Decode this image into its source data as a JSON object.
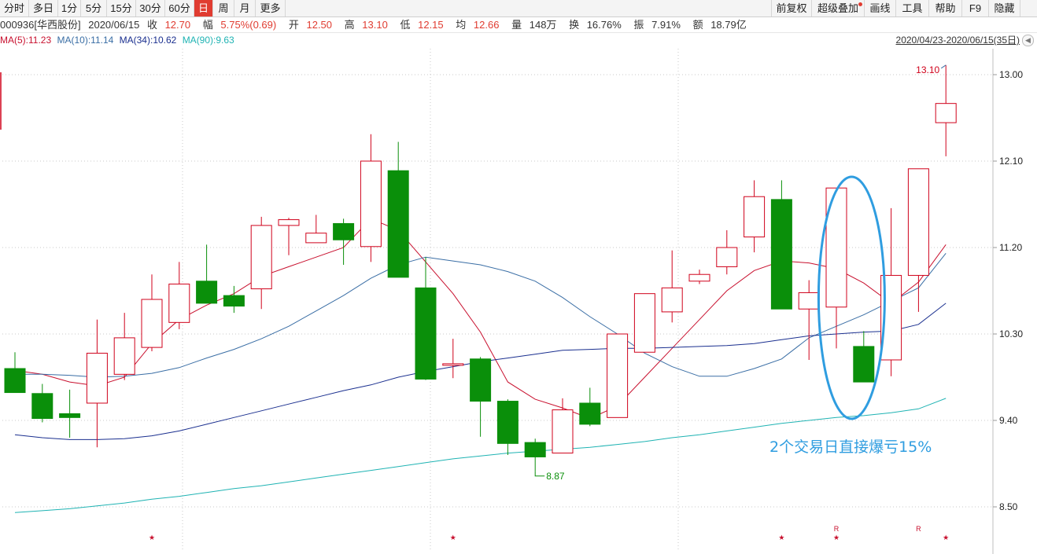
{
  "toolbar": {
    "left_items": [
      "分时",
      "多日",
      "1分",
      "5分",
      "15分",
      "30分",
      "60分",
      "日",
      "周",
      "月",
      "更多"
    ],
    "active": "日",
    "right_items": [
      "前复权",
      "超级叠加",
      "画线",
      "工具",
      "帮助",
      "F9",
      "隐藏"
    ]
  },
  "info": {
    "code_name": "000936[华西股份]",
    "date": "2020/06/15",
    "close_label": "收",
    "close": "12.70",
    "change_label": "幅",
    "change": "5.75%(0.69)",
    "open_label": "开",
    "open": "12.50",
    "high_label": "高",
    "high": "13.10",
    "low_label": "低",
    "low": "12.15",
    "avg_label": "均",
    "avg": "12.66",
    "volume_label": "量",
    "volume": "148万",
    "turnover_label": "换",
    "turnover": "16.76%",
    "amplitude_label": "振",
    "amplitude": "7.91%",
    "amount_label": "额",
    "amount": "18.79亿"
  },
  "ma_legend": [
    {
      "text": "MA(5):11.23",
      "color": "#c8102e"
    },
    {
      "text": "MA(10):11.14",
      "color": "#3a6ea5"
    },
    {
      "text": "MA(34):10.62",
      "color": "#1a2f8f"
    },
    {
      "text": "MA(90):9.63",
      "color": "#1fb3b3"
    }
  ],
  "range": "2020/04/23-2020/06/15(35日)",
  "chart_data": {
    "type": "candlestick",
    "yticks": [
      13.0,
      12.1,
      11.2,
      10.3,
      9.4,
      8.5
    ],
    "ylim": [
      8.1,
      13.3
    ],
    "up_color": "#d0021b",
    "down_color": "#0a8f0a",
    "candles": [
      [
        9.94,
        9.69,
        10.11,
        9.69
      ],
      [
        9.68,
        9.42,
        9.78,
        9.38
      ],
      [
        9.47,
        9.43,
        9.72,
        9.22
      ],
      [
        9.58,
        10.1,
        10.45,
        9.12
      ],
      [
        9.88,
        10.26,
        10.52,
        9.82
      ],
      [
        10.16,
        10.66,
        10.92,
        10.12
      ],
      [
        10.42,
        10.82,
        11.05,
        10.35
      ],
      [
        10.85,
        10.62,
        11.23,
        10.62
      ],
      [
        10.7,
        10.59,
        10.8,
        10.52
      ],
      [
        10.77,
        11.43,
        11.52,
        10.56
      ],
      [
        11.43,
        11.49,
        11.51,
        11.12
      ],
      [
        11.25,
        11.35,
        11.54,
        11.25
      ],
      [
        11.45,
        11.28,
        11.5,
        11.02
      ],
      [
        11.21,
        12.1,
        12.38,
        11.05
      ],
      [
        12.0,
        10.89,
        12.3,
        10.89
      ],
      [
        10.78,
        9.83,
        11.1,
        9.82
      ],
      [
        9.98,
        9.99,
        10.25,
        9.84
      ],
      [
        10.04,
        9.6,
        10.06,
        9.23
      ],
      [
        9.6,
        9.16,
        9.62,
        9.04
      ],
      [
        9.17,
        9.02,
        9.21,
        8.87
      ],
      [
        9.06,
        9.51,
        9.63,
        9.06
      ],
      [
        9.58,
        9.36,
        9.74,
        9.34
      ],
      [
        9.43,
        10.3,
        10.3,
        9.43
      ],
      [
        10.11,
        10.72,
        10.72,
        10.11
      ],
      [
        10.53,
        10.78,
        11.17,
        10.42
      ],
      [
        10.85,
        10.92,
        10.97,
        10.82
      ],
      [
        11.0,
        11.2,
        11.38,
        10.92
      ],
      [
        11.31,
        11.73,
        11.9,
        11.15
      ],
      [
        11.7,
        10.56,
        11.9,
        10.56
      ],
      [
        10.56,
        10.73,
        10.86,
        10.03
      ],
      [
        10.58,
        11.82,
        11.82,
        10.15
      ],
      [
        10.17,
        9.8,
        10.33,
        9.82
      ],
      [
        10.03,
        10.91,
        11.61,
        9.86
      ],
      [
        10.91,
        12.02,
        12.02,
        10.53
      ],
      [
        12.5,
        12.7,
        13.1,
        12.15
      ]
    ],
    "ma_series": [
      {
        "name": "MA(5)",
        "color": "#c8102e",
        "values": [
          9.92,
          9.88,
          9.8,
          9.76,
          9.85,
          10.2,
          10.45,
          10.6,
          10.72,
          10.9,
          11.0,
          11.1,
          11.2,
          11.5,
          11.38,
          11.05,
          10.72,
          10.32,
          9.8,
          9.62,
          9.53,
          9.42,
          9.55,
          9.85,
          10.15,
          10.45,
          10.75,
          10.96,
          11.06,
          11.04,
          10.98,
          10.83,
          10.62,
          10.84,
          11.23
        ]
      },
      {
        "name": "MA(10)",
        "color": "#3a6ea5",
        "values": [
          9.88,
          9.88,
          9.87,
          9.85,
          9.86,
          9.89,
          9.95,
          10.05,
          10.14,
          10.25,
          10.38,
          10.54,
          10.7,
          10.88,
          11.02,
          11.1,
          11.06,
          11.02,
          10.95,
          10.85,
          10.68,
          10.48,
          10.3,
          10.1,
          9.96,
          9.86,
          9.86,
          9.94,
          10.04,
          10.26,
          10.38,
          10.5,
          10.64,
          10.78,
          11.14
        ]
      },
      {
        "name": "MA(34)",
        "color": "#1a2f8f",
        "values": [
          9.25,
          9.22,
          9.2,
          9.2,
          9.21,
          9.24,
          9.29,
          9.36,
          9.43,
          9.5,
          9.57,
          9.64,
          9.71,
          9.77,
          9.85,
          9.91,
          9.96,
          10.01,
          10.05,
          10.09,
          10.13,
          10.14,
          10.15,
          10.15,
          10.16,
          10.17,
          10.18,
          10.2,
          10.24,
          10.28,
          10.3,
          10.32,
          10.33,
          10.4,
          10.62
        ]
      },
      {
        "name": "MA(90)",
        "color": "#1fb3b3",
        "values": [
          8.44,
          8.46,
          8.48,
          8.51,
          8.54,
          8.58,
          8.61,
          8.65,
          8.69,
          8.72,
          8.76,
          8.8,
          8.84,
          8.88,
          8.92,
          8.96,
          9.0,
          9.03,
          9.06,
          9.08,
          9.1,
          9.12,
          9.15,
          9.18,
          9.22,
          9.25,
          9.29,
          9.33,
          9.37,
          9.4,
          9.43,
          9.45,
          9.48,
          9.52,
          9.63
        ]
      }
    ],
    "annotations": {
      "high_label": "13.10",
      "low_label": "8.87",
      "note": "2个交易日直接爆亏15%",
      "note_color": "#2f9de0"
    },
    "markers": [
      {
        "index": 5,
        "symbol": "★"
      },
      {
        "index": 16,
        "symbol": "★"
      },
      {
        "index": 28,
        "symbol": "★"
      },
      {
        "index": 30,
        "symbol": "★",
        "tag": "R"
      },
      {
        "index": 33,
        "symbol": "",
        "tag": "R"
      },
      {
        "index": 34,
        "symbol": "★"
      }
    ]
  }
}
